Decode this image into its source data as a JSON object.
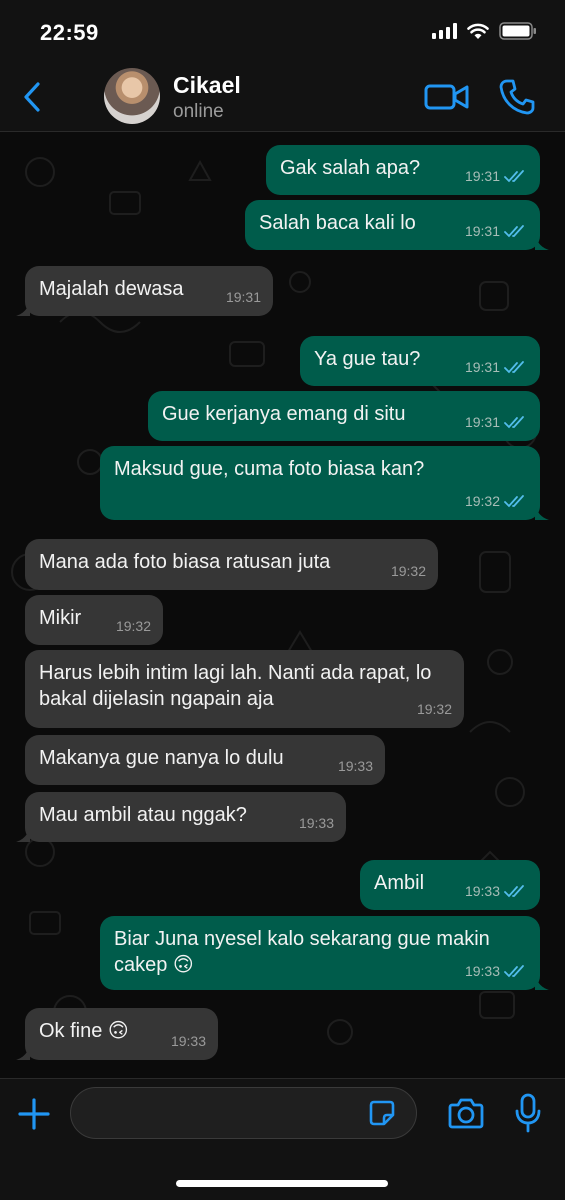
{
  "status_bar": {
    "time": "22:59"
  },
  "header": {
    "contact_name": "Cikael",
    "contact_status": "online"
  },
  "colors": {
    "accent": "#2196f3",
    "bubble_out": "#005c4b",
    "bubble_in": "#363636",
    "read_ticks": "#53bdeb"
  },
  "icons": [
    "back-icon",
    "video-call-icon",
    "voice-call-icon",
    "plus-icon",
    "sticker-icon",
    "camera-icon",
    "microphone-icon"
  ],
  "messages": [
    {
      "dir": "out",
      "text": "Gak salah apa?",
      "time": "19:31",
      "status": "read"
    },
    {
      "dir": "out",
      "text": "Salah baca kali lo",
      "time": "19:31",
      "status": "read"
    },
    {
      "dir": "in",
      "text": "Majalah dewasa",
      "time": "19:31"
    },
    {
      "dir": "out",
      "text": "Ya gue tau?",
      "time": "19:31",
      "status": "read"
    },
    {
      "dir": "out",
      "text": "Gue kerjanya emang di situ",
      "time": "19:31",
      "status": "read"
    },
    {
      "dir": "out",
      "text": "Maksud gue, cuma foto biasa kan?",
      "time": "19:32",
      "status": "read"
    },
    {
      "dir": "in",
      "text": "Mana ada foto biasa ratusan juta",
      "time": "19:32"
    },
    {
      "dir": "in",
      "text": "Mikir",
      "time": "19:32"
    },
    {
      "dir": "in",
      "text": "Harus lebih intim lagi lah. Nanti ada rapat, lo bakal dijelasin ngapain aja",
      "time": "19:32"
    },
    {
      "dir": "in",
      "text": "Makanya gue nanya lo dulu",
      "time": "19:33"
    },
    {
      "dir": "in",
      "text": "Mau ambil atau nggak?",
      "time": "19:33"
    },
    {
      "dir": "out",
      "text": "Ambil",
      "time": "19:33",
      "status": "read"
    },
    {
      "dir": "out",
      "text": "Biar Juna nyesel kalo sekarang gue makin cakep 🙃",
      "time": "19:33",
      "status": "read"
    },
    {
      "dir": "in",
      "text": "Ok fine 🙃",
      "time": "19:33"
    }
  ],
  "composer": {
    "placeholder": ""
  }
}
